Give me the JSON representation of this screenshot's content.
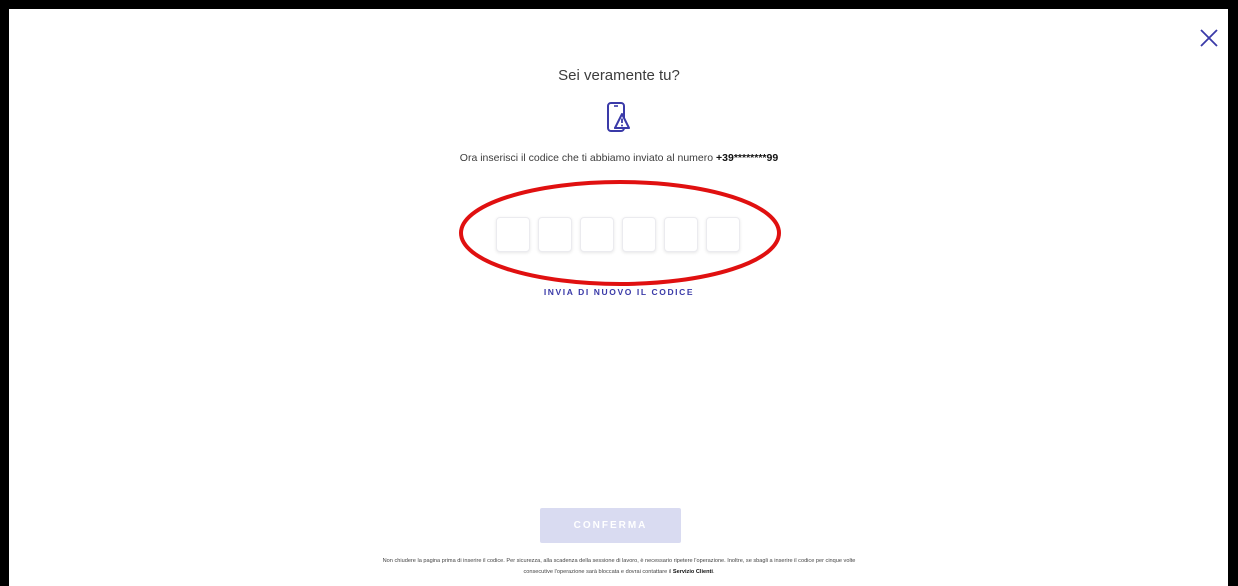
{
  "dialog": {
    "title": "Sei veramente tu?",
    "icon": "phone-alert-icon",
    "instruction_prefix": "Ora inserisci il codice che ti abbiamo inviato al numero",
    "phone_number": "+39********99",
    "otp_digits": [
      "",
      "",
      "",
      "",
      "",
      ""
    ],
    "resend_label": "INVIA DI NUOVO IL CODICE",
    "confirm_label": "CONFERMA",
    "confirm_enabled": false,
    "footer_line1": "Non chiudere la pagina prima di inserire il codice. Per sicurezza, alla scadenza della sessione di lavoro, è necessario ripetere l'operazione. Inoltre, se sbagli a inserire il codice per cinque volte",
    "footer_line2_prefix": "consecutive l'operazione sarà bloccata e dovrai contattare il",
    "footer_link": "Servizio Clienti",
    "footer_suffix": "."
  },
  "colors": {
    "accent": "#3a3aa8",
    "annotation": "#e01010",
    "confirm_disabled_bg": "#d9dbf1"
  },
  "icons": {
    "close": "close-icon"
  }
}
